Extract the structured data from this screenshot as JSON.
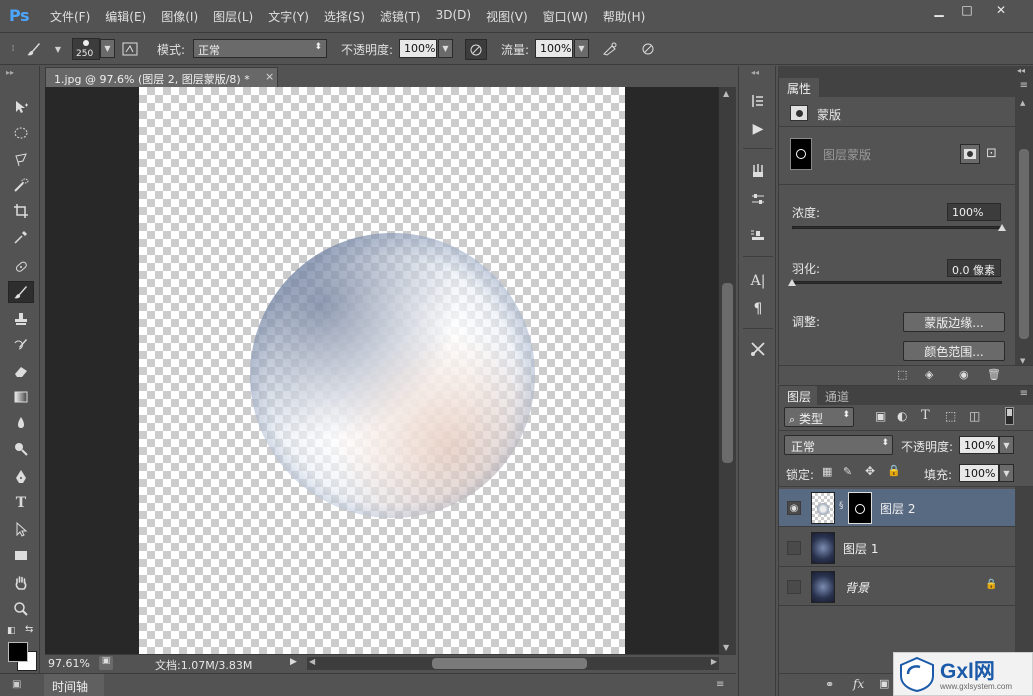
{
  "app": {
    "logo": "Ps"
  },
  "menu": [
    "文件(F)",
    "编辑(E)",
    "图像(I)",
    "图层(L)",
    "文字(Y)",
    "选择(S)",
    "滤镜(T)",
    "3D(D)",
    "视图(V)",
    "窗口(W)",
    "帮助(H)"
  ],
  "window_controls": {
    "minimize": "▁",
    "maximize": "□",
    "close": "✕"
  },
  "options": {
    "brush_size": "250",
    "mode_label": "模式:",
    "mode_value": "正常",
    "opacity_label": "不透明度:",
    "opacity_value": "100%",
    "flow_label": "流量:",
    "flow_value": "100%"
  },
  "document": {
    "tab_title": "1.jpg @ 97.6% (图层 2, 图层蒙版/8) *",
    "close": "×"
  },
  "status": {
    "zoom": "97.61%",
    "doc_info": "文档:1.07M/3.83M"
  },
  "timeline": {
    "label": "时间轴"
  },
  "properties": {
    "tab": "属性",
    "section": "蒙版",
    "mask_label": "图层蒙版",
    "density_label": "浓度:",
    "density_value": "100%",
    "density_fraction": 1.0,
    "feather_label": "羽化:",
    "feather_value": "0.0 像素",
    "feather_fraction": 0.0,
    "adjust_label": "调整:",
    "mask_edge_button": "蒙版边缘...",
    "color_range_button": "颜色范围..."
  },
  "layers": {
    "tabs": [
      "图层",
      "通道"
    ],
    "filter_label": "类型",
    "blend_mode": "正常",
    "opacity_label": "不透明度:",
    "opacity_value": "100%",
    "lock_label": "锁定:",
    "fill_label": "填充:",
    "fill_value": "100%",
    "items": [
      {
        "name": "图层 2",
        "visible": true,
        "selected": true
      },
      {
        "name": "图层 1",
        "visible": false,
        "selected": false
      },
      {
        "name": "背景",
        "visible": false,
        "selected": false
      }
    ],
    "footer_icons": [
      "link-icon",
      "fx-icon"
    ],
    "fx_label": "fx"
  },
  "watermark": {
    "brand": "Gxl网",
    "url": "www.gxlsystem.com"
  },
  "colors": {
    "ui_bg": "#535353",
    "canvas_bg": "#282828",
    "selected_layer": "#586a82",
    "ps_blue": "#4da6ff"
  }
}
